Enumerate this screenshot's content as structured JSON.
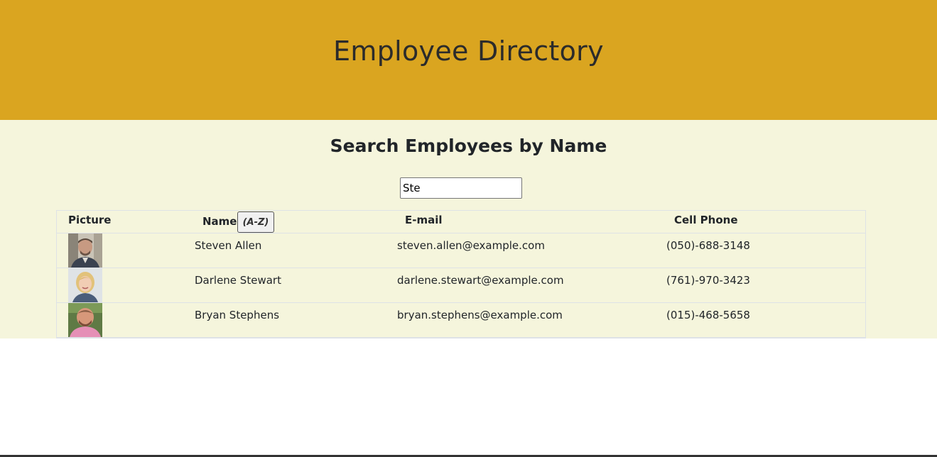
{
  "header": {
    "title": "Employee Directory"
  },
  "main": {
    "heading": "Search Employees by Name",
    "search": {
      "value": "Ste"
    }
  },
  "table": {
    "columns": {
      "picture": "Picture",
      "name": "Name",
      "sort_label": "(A-Z)",
      "email": "E-mail",
      "phone": "Cell Phone"
    },
    "rows": [
      {
        "name": "Steven Allen",
        "email": "steven.allen@example.com",
        "phone": "(050)-688-3148"
      },
      {
        "name": "Darlene Stewart",
        "email": "darlene.stewart@example.com",
        "phone": "(761)-970-3423"
      },
      {
        "name": "Bryan Stephens",
        "email": "bryan.stephens@example.com",
        "phone": "(015)-468-5658"
      }
    ]
  },
  "colors": {
    "header_bg": "#daa520",
    "main_bg": "#f5f5dc"
  }
}
